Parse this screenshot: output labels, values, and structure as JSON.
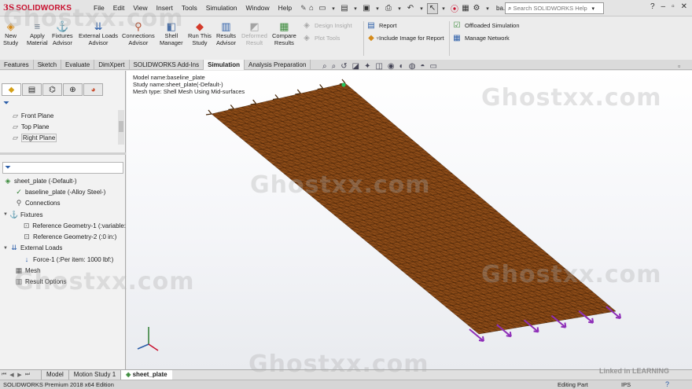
{
  "app": {
    "logo_ds": "3S",
    "logo_name": "SOLIDWORKS",
    "doc_short": "ba..."
  },
  "menus": [
    "File",
    "Edit",
    "View",
    "Insert",
    "Tools",
    "Simulation",
    "Window",
    "Help"
  ],
  "search": {
    "placeholder": "Search SOLIDWORKS Help"
  },
  "commands": {
    "new_study": [
      "New",
      "Study"
    ],
    "apply_material": [
      "Apply",
      "Material"
    ],
    "fixtures_advisor": [
      "Fixtures",
      "Advisor"
    ],
    "external_loads_advisor": [
      "External Loads",
      "Advisor"
    ],
    "connections_advisor": [
      "Connections",
      "Advisor"
    ],
    "shell_manager": [
      "Shell",
      "Manager"
    ],
    "run_this_study": [
      "Run This",
      "Study"
    ],
    "results_advisor": [
      "Results",
      "Advisor"
    ],
    "deformed_result": [
      "Deformed",
      "Result"
    ],
    "compare_results": [
      "Compare",
      "Results"
    ],
    "design_insight": "Design Insight",
    "plot_tools": "Plot Tools",
    "report": "Report",
    "include_image": "Include Image for Report",
    "offloaded_simulation": "Offloaded Simulation",
    "manage_network": "Manage Network"
  },
  "tabs": [
    "Features",
    "Sketch",
    "Evaluate",
    "DimXpert",
    "SOLIDWORKS Add-Ins",
    "Simulation",
    "Analysis Preparation"
  ],
  "active_tab": "Simulation",
  "planes": [
    "Front Plane",
    "Top Plane",
    "Right Plane"
  ],
  "tree": {
    "root": "sheet_plate (-Default-)",
    "part": "baseline_plate (-Alloy Steel-)",
    "connections": "Connections",
    "fixtures": "Fixtures",
    "fixture_1": "Reference Geometry-1 (:variable:",
    "fixture_2": "Reference Geometry-2 (:0 in:)",
    "external_loads": "External Loads",
    "force_1": "Force-1 (:Per item: 1000 lbf:)",
    "mesh": "Mesh",
    "result_options": "Result Options"
  },
  "viewport": {
    "model_name": "Model name:baseline_plate",
    "study_name": "Study name:sheet_plate(-Default-)",
    "mesh_type": "Mesh type: Shell Mesh Using Mid-surfaces",
    "mesh_color": "#8a4a17",
    "mesh_line_color": "#3b1d07",
    "fixture_color": "#4a2a0c",
    "load_color": "#8e2eb8"
  },
  "bottom_tabs": [
    "Model",
    "Motion Study 1",
    "sheet_plate"
  ],
  "active_bottom_tab": "sheet_plate",
  "status": {
    "edition": "SOLIDWORKS Premium 2018 x64 Edition",
    "mode": "Editing Part",
    "units": "IPS"
  },
  "watermark": "Ghostxx.com",
  "linkedin": "Linked in LEARNING"
}
